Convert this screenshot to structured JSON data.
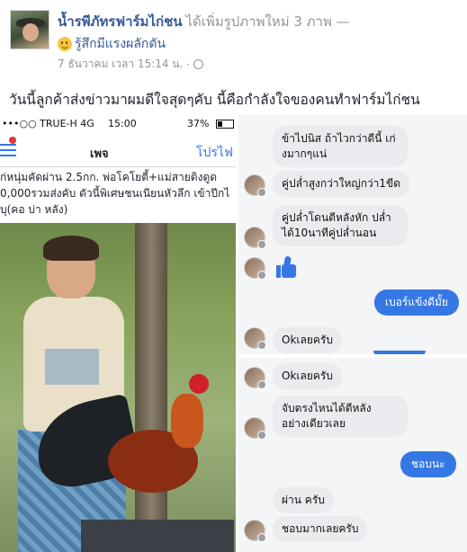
{
  "post": {
    "author": "น้ำรพีภัทรฟาร์มไก่ชน",
    "action": "ได้เพิ่มรูปภาพใหม่ 3 ภาพ —",
    "feeling": "รู้สึกมีแรงผลักดัน",
    "timestamp": "7 ธันวาคม เวลา 15:14 น.",
    "separator": "·",
    "text": "วันนี้ลูกค้าส่งข่าวมาผมดีใจสุดๆคับ นี้คือกำลังใจของคนทำฟาร์มไก่ชน"
  },
  "left_phone": {
    "carrier": "•••○○ TRUE-H  4G",
    "time": "15:00",
    "battery": "37%",
    "nav_title": "เพจ",
    "nav_right": "โปรไฟ",
    "listing_lines": [
      "ก่หนุ่มคัดผ่าน 2.5กก. พ่อโคโยตี้+แม่สายดิงดูด",
      "0,000รวมส่งคับ ตัวนี้พิเศษชนเนียนหัวลึก เข้าปีกไ",
      "บุ(คอ บ่า หลัง)"
    ]
  },
  "chat": {
    "messages": [
      {
        "from": "in",
        "text": "ข้าไปนิส ถ้าไวกว่าดีนี้ เก่งมากๆแน่"
      },
      {
        "from": "in",
        "text": "คู่ปล่ำสูงกว่าใหญ่กว่า1ขีด"
      },
      {
        "from": "in",
        "text": "คู่ปล่ำโดนตีหลังหัก ปล่ำได้10นาทีคู่ปล่ำนอน"
      },
      {
        "from": "in",
        "text": "👍"
      },
      {
        "from": "out",
        "text": "เบอร์แข้งดีมั้ย"
      },
      {
        "from": "in",
        "text": "Okเลยครับ"
      },
      {
        "from": "in",
        "text": "Okเลยครับ"
      },
      {
        "from": "in",
        "text": "จับตรงไหนได้ตีหลัง อย่างเดียวเลย"
      },
      {
        "from": "out",
        "text": "ชอบนะ"
      },
      {
        "from": "in",
        "text": "ผ่าน ครับ"
      },
      {
        "from": "in",
        "text": "ชอบมากเลยครับ"
      }
    ]
  },
  "colors": {
    "link_blue": "#365899",
    "meta_gray": "#90949c",
    "messenger_blue": "#3578e5",
    "bubble_gray": "#e9ebee"
  },
  "icons": [
    "avatar",
    "smile-emoji-icon",
    "globe-icon",
    "hamburger-menu-icon",
    "thumbs-up-icon",
    "battery-icon"
  ]
}
